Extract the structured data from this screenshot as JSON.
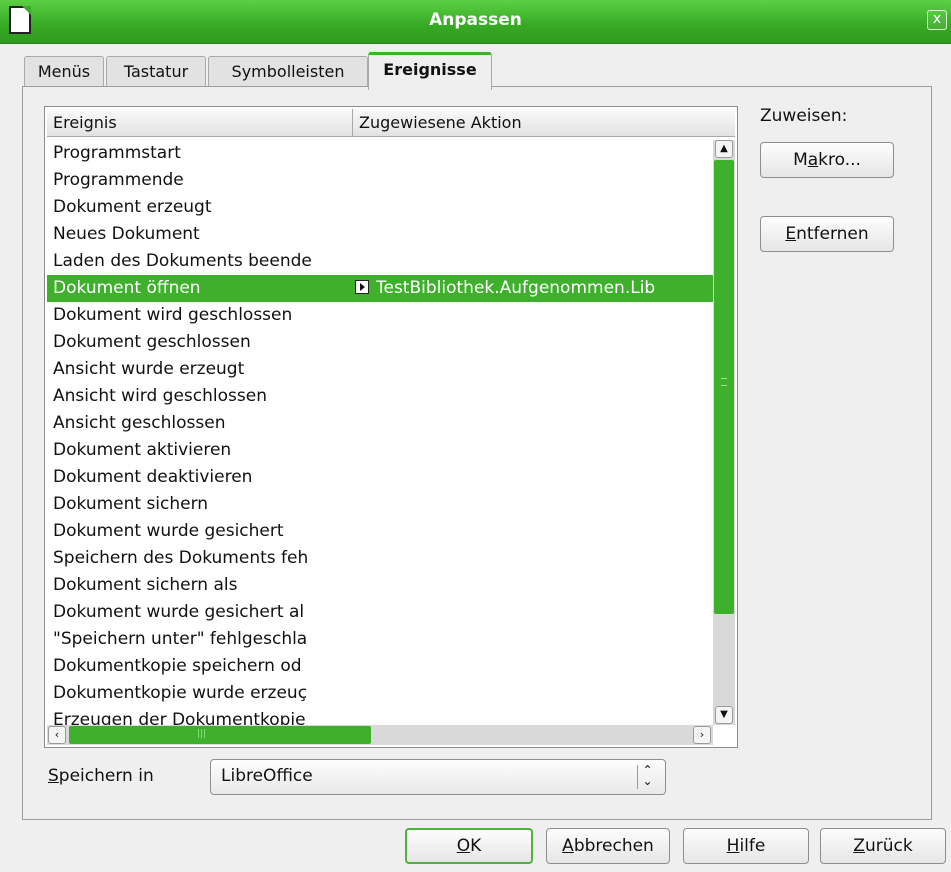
{
  "window": {
    "title": "Anpassen",
    "close_label": "x"
  },
  "tabs": [
    {
      "label": "Menüs"
    },
    {
      "label": "Tastatur"
    },
    {
      "label": "Symbolleisten"
    },
    {
      "label": "Ereignisse",
      "active": true
    }
  ],
  "table": {
    "columns": [
      "Ereignis",
      "Zugewiesene Aktion"
    ],
    "rows": [
      {
        "event": "Programmstart",
        "action": ""
      },
      {
        "event": "Programmende",
        "action": ""
      },
      {
        "event": "Dokument erzeugt",
        "action": ""
      },
      {
        "event": "Neues Dokument",
        "action": ""
      },
      {
        "event": "Laden des Dokuments beende",
        "action": ""
      },
      {
        "event": "Dokument öffnen",
        "action": "TestBibliothek.Aufgenommen.Lib",
        "selected": true,
        "action_icon": "macro-icon"
      },
      {
        "event": "Dokument wird geschlossen",
        "action": ""
      },
      {
        "event": "Dokument geschlossen",
        "action": ""
      },
      {
        "event": "Ansicht wurde erzeugt",
        "action": ""
      },
      {
        "event": "Ansicht wird geschlossen",
        "action": ""
      },
      {
        "event": "Ansicht geschlossen",
        "action": ""
      },
      {
        "event": "Dokument aktivieren",
        "action": ""
      },
      {
        "event": "Dokument deaktivieren",
        "action": ""
      },
      {
        "event": "Dokument sichern",
        "action": ""
      },
      {
        "event": "Dokument wurde gesichert",
        "action": ""
      },
      {
        "event": "Speichern des Dokuments feh",
        "action": ""
      },
      {
        "event": "Dokument sichern als",
        "action": ""
      },
      {
        "event": "Dokument wurde gesichert al",
        "action": ""
      },
      {
        "event": "\"Speichern unter\" fehlgeschla",
        "action": ""
      },
      {
        "event": "Dokumentkopie speichern od",
        "action": ""
      },
      {
        "event": "Dokumentkopie wurde erzeuç",
        "action": ""
      },
      {
        "event": "Erzeugen der Dokumentkopie",
        "action": ""
      }
    ]
  },
  "assign": {
    "label": "Zuweisen:",
    "macro_button": {
      "pre": "M",
      "acc": "a",
      "post": "kro..."
    },
    "remove_button": {
      "pre": "",
      "acc": "E",
      "post": "ntfernen"
    }
  },
  "save_in": {
    "label_acc": "S",
    "label_rest": "peichern in",
    "value": "LibreOffice"
  },
  "footer": {
    "ok": {
      "acc": "O",
      "post": "K"
    },
    "cancel": {
      "acc": "A",
      "post": "bbrechen"
    },
    "help": {
      "acc": "H",
      "post": "ilfe"
    },
    "reset": {
      "acc": "Z",
      "post": "urück"
    }
  },
  "colors": {
    "accent": "#3eb02c"
  }
}
